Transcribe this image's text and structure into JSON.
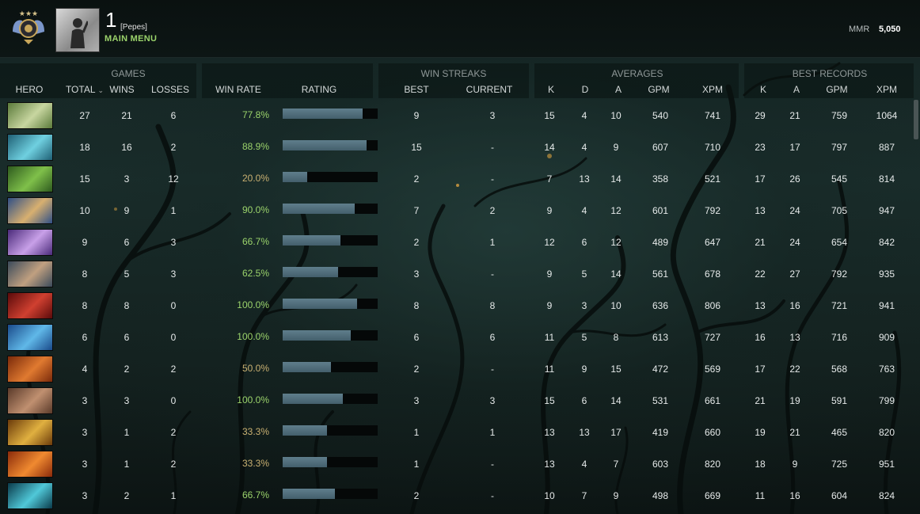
{
  "header": {
    "player_number": "1",
    "player_tag": "[Pepes]",
    "main_menu_label": "MAIN MENU",
    "mmr_label": "MMR",
    "mmr_value": "5,050"
  },
  "groups": {
    "games": "GAMES",
    "win_streaks": "WIN STREAKS",
    "averages": "AVERAGES",
    "best_records": "BEST RECORDS"
  },
  "columns": {
    "hero": "HERO",
    "total": "TOTAL",
    "wins": "WINS",
    "losses": "LOSSES",
    "win_rate": "WIN RATE",
    "rating": "RATING",
    "best": "BEST",
    "current": "CURRENT",
    "avg_k": "K",
    "avg_d": "D",
    "avg_a": "A",
    "avg_gpm": "GPM",
    "avg_xpm": "XPM",
    "rec_k": "K",
    "rec_a": "A",
    "rec_gpm": "GPM",
    "rec_xpm": "XPM"
  },
  "rows": [
    {
      "hero": "hero-1",
      "colors": [
        "#5a7a3a",
        "#c8d6a0"
      ],
      "total": "27",
      "wins": "21",
      "losses": "6",
      "win_rate": "77.8%",
      "rating": 0.84,
      "best": "9",
      "current": "3",
      "k": "15",
      "d": "4",
      "a": "10",
      "gpm": "540",
      "xpm": "741",
      "rk": "29",
      "ra": "21",
      "rgpm": "759",
      "rxpm": "1064"
    },
    {
      "hero": "hero-2",
      "colors": [
        "#1f5f74",
        "#6fd0e0"
      ],
      "total": "18",
      "wins": "16",
      "losses": "2",
      "win_rate": "88.9%",
      "rating": 0.88,
      "best": "15",
      "current": "-",
      "k": "14",
      "d": "4",
      "a": "9",
      "gpm": "607",
      "xpm": "710",
      "rk": "23",
      "ra": "17",
      "rgpm": "797",
      "rxpm": "887"
    },
    {
      "hero": "hero-3",
      "colors": [
        "#2e5a1e",
        "#7fc04a"
      ],
      "total": "15",
      "wins": "3",
      "losses": "12",
      "win_rate": "20.0%",
      "rating": 0.26,
      "best": "2",
      "current": "-",
      "k": "7",
      "d": "13",
      "a": "14",
      "gpm": "358",
      "xpm": "521",
      "rk": "17",
      "ra": "26",
      "rgpm": "545",
      "rxpm": "814"
    },
    {
      "hero": "hero-4",
      "colors": [
        "#2f4f86",
        "#d8b070"
      ],
      "total": "10",
      "wins": "9",
      "losses": "1",
      "win_rate": "90.0%",
      "rating": 0.76,
      "best": "7",
      "current": "2",
      "k": "9",
      "d": "4",
      "a": "12",
      "gpm": "601",
      "xpm": "792",
      "rk": "13",
      "ra": "24",
      "rgpm": "705",
      "rxpm": "947"
    },
    {
      "hero": "hero-5",
      "colors": [
        "#4a2a7a",
        "#c8a0e8"
      ],
      "total": "9",
      "wins": "6",
      "losses": "3",
      "win_rate": "66.7%",
      "rating": 0.61,
      "best": "2",
      "current": "1",
      "k": "12",
      "d": "6",
      "a": "12",
      "gpm": "489",
      "xpm": "647",
      "rk": "21",
      "ra": "24",
      "rgpm": "654",
      "rxpm": "842"
    },
    {
      "hero": "hero-6",
      "colors": [
        "#3a4a5a",
        "#c0a080"
      ],
      "total": "8",
      "wins": "5",
      "losses": "3",
      "win_rate": "62.5%",
      "rating": 0.58,
      "best": "3",
      "current": "-",
      "k": "9",
      "d": "5",
      "a": "14",
      "gpm": "561",
      "xpm": "678",
      "rk": "22",
      "ra": "27",
      "rgpm": "792",
      "rxpm": "935"
    },
    {
      "hero": "hero-7",
      "colors": [
        "#5a0a0a",
        "#d04030"
      ],
      "total": "8",
      "wins": "8",
      "losses": "0",
      "win_rate": "100.0%",
      "rating": 0.78,
      "best": "8",
      "current": "8",
      "k": "9",
      "d": "3",
      "a": "10",
      "gpm": "636",
      "xpm": "806",
      "rk": "13",
      "ra": "16",
      "rgpm": "721",
      "rxpm": "941"
    },
    {
      "hero": "hero-8",
      "colors": [
        "#1a4a8a",
        "#60b8e8"
      ],
      "total": "6",
      "wins": "6",
      "losses": "0",
      "win_rate": "100.0%",
      "rating": 0.72,
      "best": "6",
      "current": "6",
      "k": "11",
      "d": "5",
      "a": "8",
      "gpm": "613",
      "xpm": "727",
      "rk": "16",
      "ra": "13",
      "rgpm": "716",
      "rxpm": "909"
    },
    {
      "hero": "hero-9",
      "colors": [
        "#7a2a0a",
        "#e07a30"
      ],
      "total": "4",
      "wins": "2",
      "losses": "2",
      "win_rate": "50.0%",
      "rating": 0.51,
      "best": "2",
      "current": "-",
      "k": "11",
      "d": "9",
      "a": "15",
      "gpm": "472",
      "xpm": "569",
      "rk": "17",
      "ra": "22",
      "rgpm": "568",
      "rxpm": "763"
    },
    {
      "hero": "hero-10",
      "colors": [
        "#5a3a2a",
        "#c09070"
      ],
      "total": "3",
      "wins": "3",
      "losses": "0",
      "win_rate": "100.0%",
      "rating": 0.63,
      "best": "3",
      "current": "3",
      "k": "15",
      "d": "6",
      "a": "14",
      "gpm": "531",
      "xpm": "661",
      "rk": "21",
      "ra": "19",
      "rgpm": "591",
      "rxpm": "799"
    },
    {
      "hero": "hero-11",
      "colors": [
        "#6a3a0a",
        "#e0b040"
      ],
      "total": "3",
      "wins": "1",
      "losses": "2",
      "win_rate": "33.3%",
      "rating": 0.47,
      "best": "1",
      "current": "1",
      "k": "13",
      "d": "13",
      "a": "17",
      "gpm": "419",
      "xpm": "660",
      "rk": "19",
      "ra": "21",
      "rgpm": "465",
      "rxpm": "820"
    },
    {
      "hero": "hero-12",
      "colors": [
        "#8a2a0a",
        "#f08a30"
      ],
      "total": "3",
      "wins": "1",
      "losses": "2",
      "win_rate": "33.3%",
      "rating": 0.47,
      "best": "1",
      "current": "-",
      "k": "13",
      "d": "4",
      "a": "7",
      "gpm": "603",
      "xpm": "820",
      "rk": "18",
      "ra": "9",
      "rgpm": "725",
      "rxpm": "951"
    },
    {
      "hero": "hero-13",
      "colors": [
        "#0a3a4a",
        "#50c8d8"
      ],
      "total": "3",
      "wins": "2",
      "losses": "1",
      "win_rate": "66.7%",
      "rating": 0.55,
      "best": "2",
      "current": "-",
      "k": "10",
      "d": "7",
      "a": "9",
      "gpm": "498",
      "xpm": "669",
      "rk": "11",
      "ra": "16",
      "rgpm": "604",
      "rxpm": "824"
    }
  ]
}
